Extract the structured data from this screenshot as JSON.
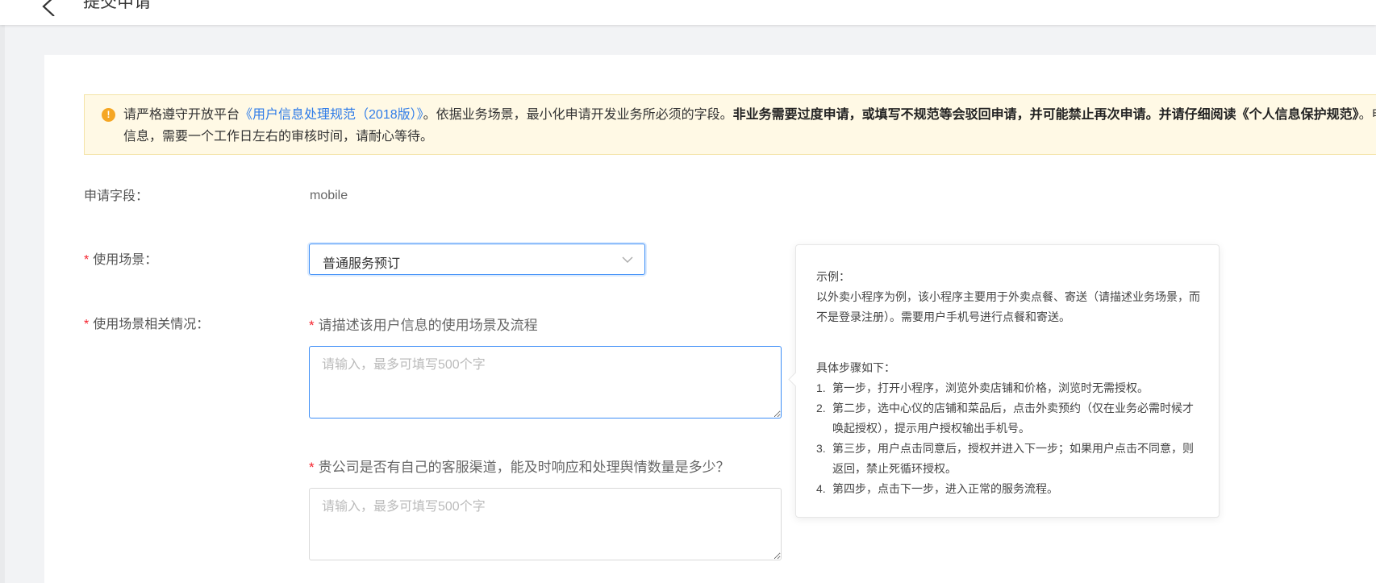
{
  "header": {
    "title": "提交申请"
  },
  "notice": {
    "prefix": "请严格遵守开放平台",
    "link": "《用户信息处理规范（2018版）》",
    "middle": "。依据业务场景，最小化申请开发业务所必须的字段。",
    "bold": "非业务需要过度申请，或填写不规范等会驳回申请，并可能禁止再次申请。并请仔细阅读《个人信息保护规范》",
    "suffix": "。申请用户信息，需要一个工作日左右的审核时间，请耐心等待。"
  },
  "form": {
    "field_label": "申请字段：",
    "field_value": "mobile",
    "scene_label": "使用场景：",
    "scene_value": "普通服务预订",
    "scene_detail_label": "使用场景相关情况：",
    "q1": "请描述该用户信息的使用场景及流程",
    "q1_placeholder": "请输入，最多可填写500个字",
    "q2": "贵公司是否有自己的客服渠道，能及时响应和处理舆情数量是多少？",
    "q2_placeholder": "请输入，最多可填写500个字"
  },
  "tooltip": {
    "title": "示例：",
    "example": "以外卖小程序为例，该小程序主要用于外卖点餐、寄送（请描述业务场景，而不是登录注册）。需要用户手机号进行点餐和寄送。",
    "steps_title": "具体步骤如下：",
    "steps": [
      {
        "num": "1.",
        "text": "第一步，打开小程序，浏览外卖店铺和价格，浏览时无需授权。"
      },
      {
        "num": "2.",
        "text": "第二步，选中心仪的店铺和菜品后，点击外卖预约（仅在业务必需时候才唤起授权），提示用户授权输出手机号。"
      },
      {
        "num": "3.",
        "text": "第三步，用户点击同意后，授权并进入下一步；如果用户点击不同意，则返回，禁止死循环授权。"
      },
      {
        "num": "4.",
        "text": "第四步，点击下一步，进入正常的服务流程。"
      }
    ]
  },
  "colors": {
    "accent": "#3d8ef7",
    "required": "#f5222d",
    "warning": "#f5a623",
    "notice_bg": "#fff9e5"
  },
  "icons": {
    "back": "back-arrow-icon",
    "warning": "warning-icon",
    "dropdown": "chevron-down-icon"
  }
}
